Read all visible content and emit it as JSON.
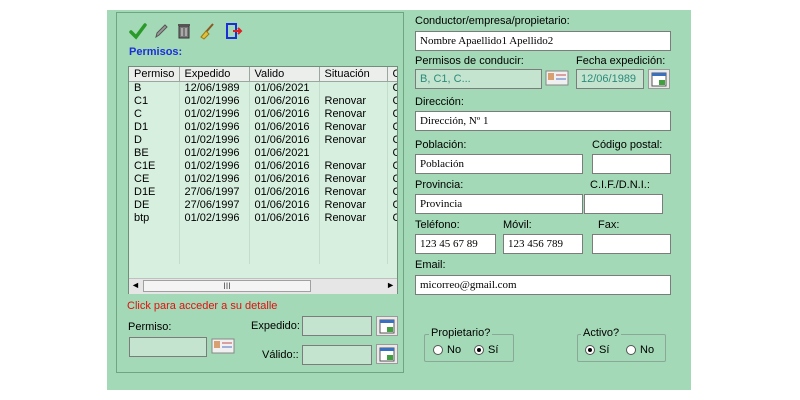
{
  "toolbar": {
    "accept_icon": "check-icon",
    "edit_icon": "pencil-icon",
    "delete_icon": "trash-icon",
    "clean_icon": "broom-icon",
    "exit_icon": "exit-door-icon"
  },
  "permisos": {
    "title": "Permisos:",
    "columns": [
      "Permiso",
      "Expedido",
      "Valido",
      "Situación",
      "C"
    ],
    "rows": [
      [
        "B",
        "12/06/1989",
        "01/06/2021",
        "",
        "C"
      ],
      [
        "C1",
        "01/02/1996",
        "01/06/2016",
        "Renovar",
        "C"
      ],
      [
        "C",
        "01/02/1996",
        "01/06/2016",
        "Renovar",
        "C"
      ],
      [
        "D1",
        "01/02/1996",
        "01/06/2016",
        "Renovar",
        "C"
      ],
      [
        "D",
        "01/02/1996",
        "01/06/2016",
        "Renovar",
        "C"
      ],
      [
        "BE",
        "01/02/1996",
        "01/06/2021",
        "",
        "C"
      ],
      [
        "C1E",
        "01/02/1996",
        "01/06/2016",
        "Renovar",
        "C"
      ],
      [
        "CE",
        "01/02/1996",
        "01/06/2016",
        "Renovar",
        "C"
      ],
      [
        "D1E",
        "27/06/1997",
        "01/06/2016",
        "Renovar",
        "C"
      ],
      [
        "DE",
        "27/06/1997",
        "01/06/2016",
        "Renovar",
        "C"
      ],
      [
        "btp",
        "01/02/1996",
        "01/06/2016",
        "Renovar",
        "C"
      ]
    ],
    "scroll_thumb_label": "III",
    "hint": "Click para acceder a su detalle",
    "permiso_label": "Permiso:",
    "expedido_label": "Expedido:",
    "valido_label": "Válido::"
  },
  "form": {
    "conductor_label": "Conductor/empresa/propietario:",
    "conductor_value": "Nombre Apaellido1 Apellido2",
    "permisos_label": "Permisos de conducir:",
    "permisos_value": "B, C1, C...",
    "fecha_label": "Fecha expedición:",
    "fecha_value": "12/06/1989",
    "direccion_label": "Dirección:",
    "direccion_value": "Dirección, Nº 1",
    "poblacion_label": "Población:",
    "poblacion_value": "Población",
    "cp_label": "Código postal:",
    "cp_value": "",
    "provincia_label": "Provincia:",
    "provincia_value": "Provincia",
    "cif_label": "C.I.F./D.N.I.:",
    "cif_value": "",
    "telefono_label": "Teléfono:",
    "telefono_value": "123 45 67 89",
    "movil_label": "Móvil:",
    "movil_value": "123 456 789",
    "fax_label": "Fax:",
    "fax_value": "",
    "email_label": "Email:",
    "email_value": "micorreo@gmail.com"
  },
  "propietario": {
    "label": "Propietario?",
    "no": "No",
    "si": "Sí",
    "selected": "si"
  },
  "activo": {
    "label": "Activo?",
    "si": "Sí",
    "no": "No",
    "selected": "si"
  },
  "colors": {
    "panel": "#a3d9b6",
    "grid": "#d7efde",
    "accent_blue": "#1b2fd8",
    "hint_red": "#e01010"
  }
}
